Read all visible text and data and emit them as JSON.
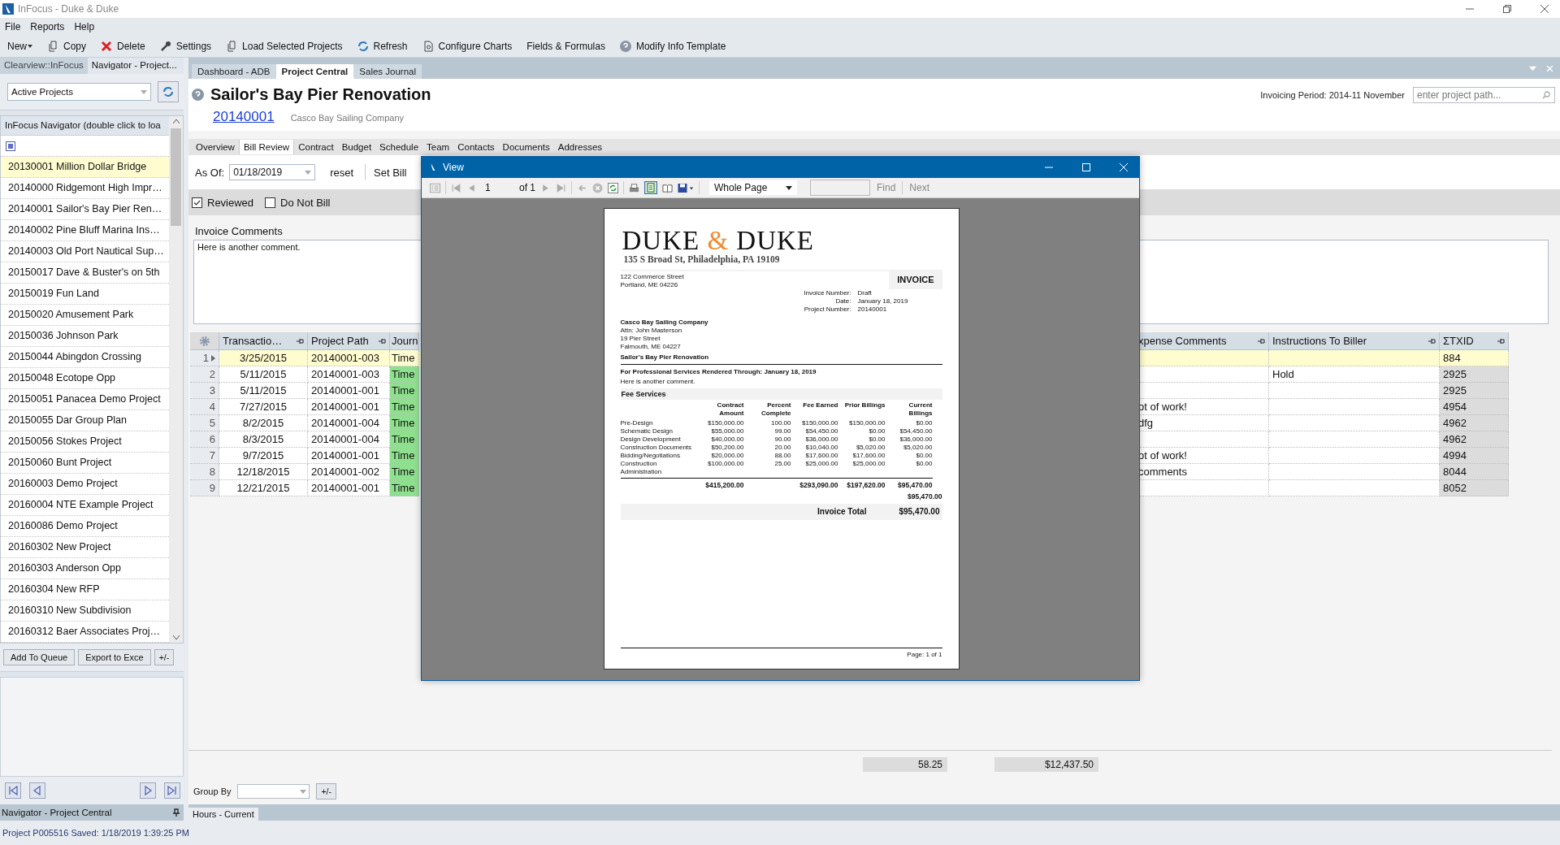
{
  "window": {
    "title": "InFocus - Duke & Duke"
  },
  "menu": [
    "File",
    "Reports",
    "Help"
  ],
  "toolbar": [
    {
      "label": "New",
      "kind": "menu"
    },
    {
      "label": "Copy",
      "kind": "icon"
    },
    {
      "label": "Delete",
      "kind": "icon"
    },
    {
      "label": "Settings",
      "kind": "icon"
    },
    {
      "label": "Load Selected Projects",
      "kind": "icon"
    },
    {
      "label": "Refresh",
      "kind": "icon"
    },
    {
      "label": "Configure Charts",
      "kind": "icon"
    },
    {
      "label": "Fields & Formulas",
      "kind": "plain"
    },
    {
      "label": "Modify Info Template",
      "kind": "icon"
    }
  ],
  "left_panel": {
    "tabs": [
      {
        "label": "Clearview::InFocus",
        "selected": false
      },
      {
        "label": "Navigator  - Project...",
        "selected": true
      }
    ],
    "filter": {
      "value": "Active Projects"
    },
    "navigator": {
      "header": "InFocus Navigator  (double click to loa",
      "items": [
        {
          "label": "20130001 Million Dollar Bridge",
          "selected": true
        },
        {
          "label": "20140000 Ridgemont High Impr…",
          "selected": false
        },
        {
          "label": "20140001 Sailor's Bay Pier Ren…",
          "selected": false
        },
        {
          "label": "20140002 Pine Bluff Marina Ins…",
          "selected": false
        },
        {
          "label": "20140003 Old Port Nautical Sup…",
          "selected": false
        },
        {
          "label": "20150017 Dave & Buster's on 5th",
          "selected": false
        },
        {
          "label": "20150019 Fun Land",
          "selected": false
        },
        {
          "label": "20150020 Amusement Park",
          "selected": false
        },
        {
          "label": "20150036 Johnson Park",
          "selected": false
        },
        {
          "label": "20150044 Abingdon Crossing",
          "selected": false
        },
        {
          "label": "20150048 Ecotope Opp",
          "selected": false
        },
        {
          "label": "20150051 Panacea Demo Project",
          "selected": false
        },
        {
          "label": "20150055 Dar Group Plan",
          "selected": false
        },
        {
          "label": "20150056 Stokes Project",
          "selected": false
        },
        {
          "label": "20150060 Bunt Project",
          "selected": false
        },
        {
          "label": "20160003 Demo Project",
          "selected": false
        },
        {
          "label": "20160004 NTE Example Project",
          "selected": false
        },
        {
          "label": "20160086 Demo Project",
          "selected": false
        },
        {
          "label": "20160302 New Project",
          "selected": false
        },
        {
          "label": "20160303 Anderson Opp",
          "selected": false
        },
        {
          "label": "20160304 New RFP",
          "selected": false
        },
        {
          "label": "20160310 New Subdivision",
          "selected": false
        },
        {
          "label": "20160312 Baer Associates Proj…",
          "selected": false
        }
      ]
    },
    "buttons": [
      "Add To Queue",
      "Export to Exce",
      "+/-"
    ],
    "footer": "Navigator  - Project Central"
  },
  "doc_tabs": [
    {
      "label": "Dashboard - ADB",
      "selected": false
    },
    {
      "label": "Project Central",
      "selected": true
    },
    {
      "label": "Sales Journal",
      "selected": false
    }
  ],
  "project": {
    "title": "Sailor's Bay Pier Renovation",
    "number": "20140001",
    "client": "Casco Bay Sailing Company",
    "invoicing_period": "Invoicing Period: 2014-11 November",
    "search": {
      "placeholder": "enter project path..."
    }
  },
  "sub_tabs": [
    {
      "label": "Overview",
      "selected": false
    },
    {
      "label": "Bill Review",
      "selected": true
    },
    {
      "label": "Contract",
      "selected": false
    },
    {
      "label": "Budget",
      "selected": false
    },
    {
      "label": "Schedule",
      "selected": false
    },
    {
      "label": "Team",
      "selected": false
    },
    {
      "label": "Contacts",
      "selected": false
    },
    {
      "label": "Documents",
      "selected": false
    },
    {
      "label": "Addresses",
      "selected": false
    }
  ],
  "bill_review": {
    "as_of_label": "As Of:",
    "as_of": "01/18/2019",
    "reset": "reset",
    "set_bill": "Set Bill",
    "reviewed": {
      "label": "Reviewed",
      "checked": true
    },
    "do_not_bill": {
      "label": "Do Not Bill",
      "checked": false
    },
    "comments_label": "Invoice Comments",
    "comments": "Here is another comment."
  },
  "grid": {
    "columns": [
      "Transactio…",
      "Project Path",
      "Journ",
      "xpense Comments",
      "Instructions To Biller",
      "ΣTXID"
    ],
    "rows": [
      {
        "number": "1",
        "selected": true,
        "date": "3/25/2015",
        "project_path": "20140001-003",
        "journal": "Time",
        "txid": "884"
      },
      {
        "number": "2",
        "selected": false,
        "date": "5/11/2015",
        "project_path": "20140001-003",
        "journal": "Time",
        "instructions": "Hold",
        "txid": "2925"
      },
      {
        "number": "3",
        "selected": false,
        "date": "5/11/2015",
        "project_path": "20140001-001",
        "journal": "Time",
        "txid": "2925"
      },
      {
        "number": "4",
        "selected": false,
        "date": "7/27/2015",
        "project_path": "20140001-001",
        "journal": "Time",
        "expense_comments": "ot of work!",
        "txid": "4954"
      },
      {
        "number": "5",
        "selected": false,
        "date": "8/2/2015",
        "project_path": "20140001-004",
        "journal": "Time",
        "expense_comments": "dfg",
        "txid": "4962"
      },
      {
        "number": "6",
        "selected": false,
        "date": "8/3/2015",
        "project_path": "20140001-004",
        "journal": "Time",
        "txid": "4962"
      },
      {
        "number": "7",
        "selected": false,
        "date": "9/7/2015",
        "project_path": "20140001-001",
        "journal": "Time",
        "expense_comments": "ot of work!",
        "txid": "4994"
      },
      {
        "number": "8",
        "selected": false,
        "date": "12/18/2015",
        "project_path": "20140001-002",
        "journal": "Time",
        "expense_comments": "comments",
        "txid": "8044"
      },
      {
        "number": "9",
        "selected": false,
        "date": "12/21/2015",
        "project_path": "20140001-001",
        "journal": "Time",
        "txid": "8052"
      }
    ],
    "totals": [
      "58.25",
      "$12,437.50"
    ]
  },
  "group_by": {
    "label": "Group By",
    "toggle": "+/-"
  },
  "bottom_tabs": [
    "Hours - Current"
  ],
  "viewer": {
    "title": "View",
    "page": "1",
    "page_count": "of 1",
    "zoom": "Whole Page",
    "find": "Find",
    "next": "Next",
    "document": {
      "logo": {
        "left": "DUKE",
        "amp": "&",
        "right": "DUKE"
      },
      "address": "135 S Broad St, Philadelphia, PA 19109",
      "from": [
        "122 Commerce Street",
        "Portland, ME 04226"
      ],
      "heading": "INVOICE",
      "meta": [
        {
          "label": "Invoice Number:",
          "value": "Draft"
        },
        {
          "label": "Date:",
          "value": "January 18, 2019"
        },
        {
          "label": "Project Number:",
          "value": "20140001"
        }
      ],
      "client": [
        "Casco Bay Sailing Company",
        "Attn: John Masterson",
        "19 Pier Street",
        "Falmouth, ME 04227"
      ],
      "project": "Sailor's Bay Pier Renovation",
      "through": "For Professional Services Rendered Through: January 18, 2019",
      "comment": "Here is another comment.",
      "section": "Fee Services",
      "columns": [
        "Contract Amount",
        "Percent Complete",
        "Fee Earned",
        "Prior Billings",
        "Current Billings"
      ],
      "rows": [
        {
          "phase": "Pre-Design",
          "values": [
            "$150,000.00",
            "100.00",
            "$150,000.00",
            "$150,000.00",
            "$0.00"
          ]
        },
        {
          "phase": "Schematic Design",
          "values": [
            "$55,000.00",
            "99.00",
            "$54,450.00",
            "$0.00",
            "$54,450.00"
          ]
        },
        {
          "phase": "Design Development",
          "values": [
            "$40,000.00",
            "90.00",
            "$36,000.00",
            "$0.00",
            "$36,000.00"
          ]
        },
        {
          "phase": "Construction Documents",
          "values": [
            "$50,200.00",
            "20.00",
            "$10,040.00",
            "$5,020.00",
            "$5,020.00"
          ]
        },
        {
          "phase": "Bidding/Negotiations",
          "values": [
            "$20,000.00",
            "88.00",
            "$17,600.00",
            "$17,600.00",
            "$0.00"
          ]
        },
        {
          "phase": "Construction Administration",
          "values": [
            "$100,000.00",
            "25.00",
            "$25,000.00",
            "$25,000.00",
            "$0.00"
          ]
        }
      ],
      "totals": {
        "contract": "$415,200.00",
        "earned": "$293,090.00",
        "prior": "$197,620.00",
        "current": "$95,470.00"
      },
      "subtotal": "$95,470.00",
      "total_label": "Invoice Total",
      "total": "$95,470.00",
      "footer": "Page: 1 of 1"
    }
  },
  "status_bar": "Project P005516 Saved: 1/18/2019 1:39:25 PM"
}
